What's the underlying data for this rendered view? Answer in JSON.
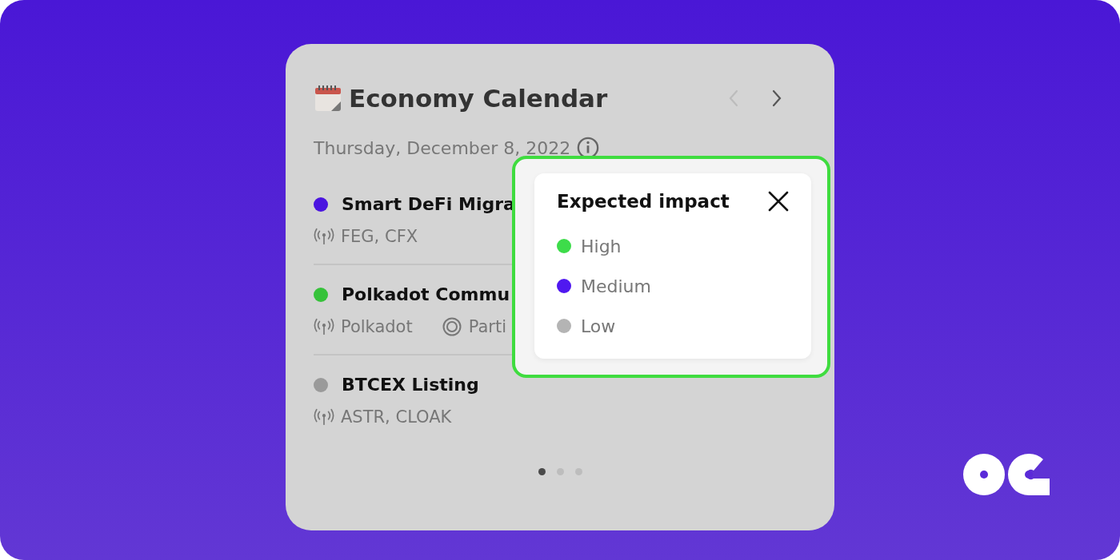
{
  "widget": {
    "title": "Economy Calendar",
    "nav": [
      {
        "kind": "prev",
        "disabled": true
      },
      {
        "kind": "next",
        "disabled": false
      }
    ],
    "date": "Thursday, December 8, 2022",
    "events": [
      {
        "title": "Smart DeFi Migra",
        "color": "#4a14e0",
        "tags": [
          {
            "kind": "coins",
            "text": "FEG, CFX"
          }
        ]
      },
      {
        "title": "Polkadot Commu",
        "color": "#36c23a",
        "tags": [
          {
            "kind": "coins",
            "text": "Polkadot"
          },
          {
            "kind": "category",
            "text": "Parti"
          }
        ]
      },
      {
        "title": "BTCEX Listing",
        "color": "#9a9a9a",
        "tags": [
          {
            "kind": "coins",
            "text": "ASTR, CLOAK"
          }
        ]
      }
    ],
    "pages": [
      {
        "selected": true
      },
      {
        "selected": false
      },
      {
        "selected": false
      }
    ]
  },
  "popover": {
    "title": "Expected impact",
    "items": [
      {
        "label": "High",
        "color": "#3ddc4a"
      },
      {
        "label": "Medium",
        "color": "#5018f0"
      },
      {
        "label": "Low",
        "color": "#b4b4b4"
      }
    ]
  }
}
